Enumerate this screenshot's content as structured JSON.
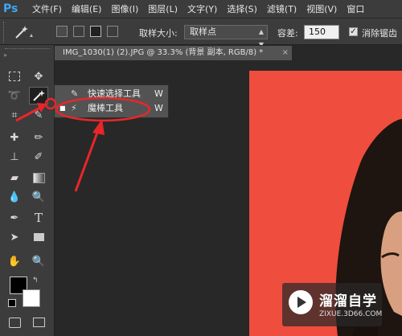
{
  "menubar": {
    "logo": "Ps",
    "items": [
      "文件(F)",
      "编辑(E)",
      "图像(I)",
      "图层(L)",
      "文字(Y)",
      "选择(S)",
      "滤镜(T)",
      "视图(V)",
      "窗口"
    ]
  },
  "options": {
    "sample_size_label": "取样大小:",
    "sample_size_value": "取样点",
    "tolerance_label": "容差:",
    "tolerance_value": "150",
    "antialias_label": "消除锯齿",
    "antialias_checked": "✓"
  },
  "document": {
    "tab_title": "IMG_1030(1) (2).JPG @ 33.3% (背景 副本, RGB/8) *",
    "close": "×",
    "canvas_color": "#ef4d3d"
  },
  "flyout": {
    "items": [
      {
        "label": "快速选择工具",
        "shortcut": "W",
        "icon": "quick-selection-icon",
        "marker": ""
      },
      {
        "label": "魔棒工具",
        "shortcut": "W",
        "icon": "magic-wand-icon",
        "marker": "■"
      }
    ]
  },
  "watermark": {
    "title": "溜溜自学",
    "subtitle": "ZIXUE.3D66.COM"
  },
  "annotation_color": "#e8262a"
}
